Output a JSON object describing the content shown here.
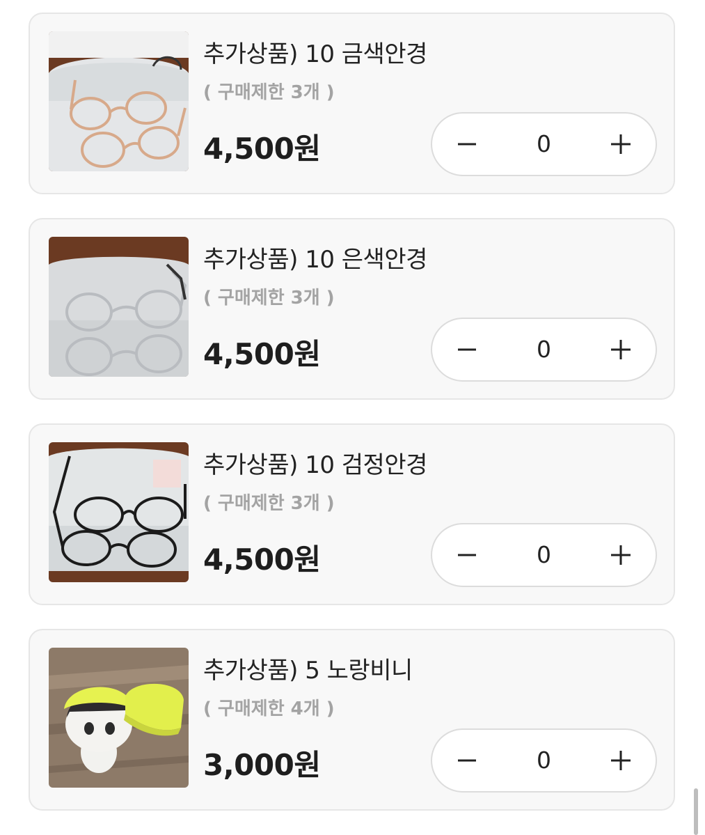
{
  "products": [
    {
      "title": "추가상품) 10 금색안경",
      "limit": "( 구매제한 3개 )",
      "price": "4,500원",
      "quantity": "0",
      "image": "gold-glasses-photo"
    },
    {
      "title": "추가상품) 10 은색안경",
      "limit": "( 구매제한 3개 )",
      "price": "4,500원",
      "quantity": "0",
      "image": "silver-glasses-photo"
    },
    {
      "title": "추가상품) 10 검정안경",
      "limit": "( 구매제한 3개 )",
      "price": "4,500원",
      "quantity": "0",
      "image": "black-glasses-photo"
    },
    {
      "title": "추가상품) 5 노랑비니",
      "limit": "( 구매제한 4개 )",
      "price": "3,000원",
      "quantity": "0",
      "image": "yellow-beanie-photo"
    }
  ],
  "icons": {
    "decrease": "minus-icon",
    "increase": "plus-icon"
  },
  "colors": {
    "card_background": "#f8f8f8",
    "card_border": "#e6e6e6",
    "limit_text": "#a3a3a3",
    "price_text": "#1e1e1e"
  }
}
